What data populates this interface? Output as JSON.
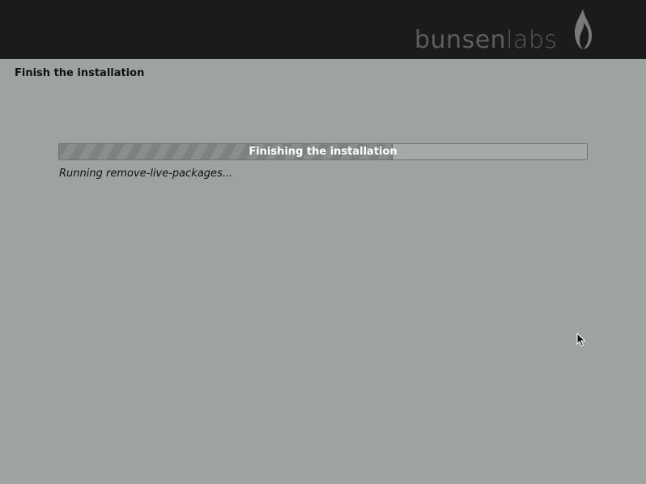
{
  "header": {
    "brand_part1": "bunsen",
    "brand_part2": "labs",
    "logo_icon": "flame-icon",
    "background_color": "#1b1b1b"
  },
  "page": {
    "title": "Finish the installation",
    "background_color": "#9fa39f"
  },
  "progress": {
    "label": "Finishing the installation",
    "fraction": 0.63
  },
  "status": {
    "text": "Running remove-live-packages..."
  },
  "cursor": {
    "icon": "mouse-pointer-icon"
  }
}
